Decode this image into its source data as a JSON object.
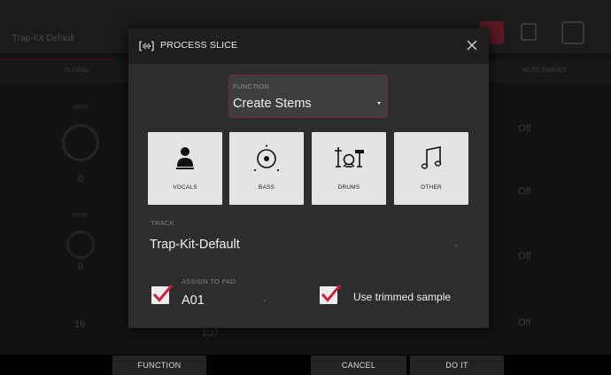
{
  "background": {
    "document_name": "Trap-Kit-Default",
    "left_header": "GLOBAL",
    "right_header": "MUTE TARGET",
    "left_labels": [
      "SEMI",
      "FINE"
    ],
    "left_values": [
      "0",
      "0",
      "16"
    ],
    "off_values": [
      "Off",
      "Off",
      "Off",
      "Off"
    ],
    "bottom_value": "100"
  },
  "dialog": {
    "title": "PROCESS SLICE",
    "function": {
      "label": "FUNCTION",
      "value": "Create Stems"
    },
    "stems": [
      {
        "label": "VOCALS",
        "icon": "person-icon"
      },
      {
        "label": "BASS",
        "icon": "speaker-icon"
      },
      {
        "label": "DRUMS",
        "icon": "drum-kit-icon"
      },
      {
        "label": "OTHER",
        "icon": "music-note-icon"
      }
    ],
    "track": {
      "label": "TRACK",
      "value": "Trap-Kit-Default"
    },
    "assign_to_pad": {
      "label": "ASSIGN TO PAD",
      "value": "A01",
      "checked": true
    },
    "use_trimmed": {
      "label": "Use trimmed sample",
      "checked": true
    }
  },
  "softkeys": {
    "function": "FUNCTION",
    "cancel": "CANCEL",
    "do_it": "DO IT"
  },
  "colors": {
    "accent": "#d01f3c",
    "dialog_bg": "#2b2d2e",
    "header_bg": "#1d1f20",
    "button_bg": "#e4e4e4"
  }
}
